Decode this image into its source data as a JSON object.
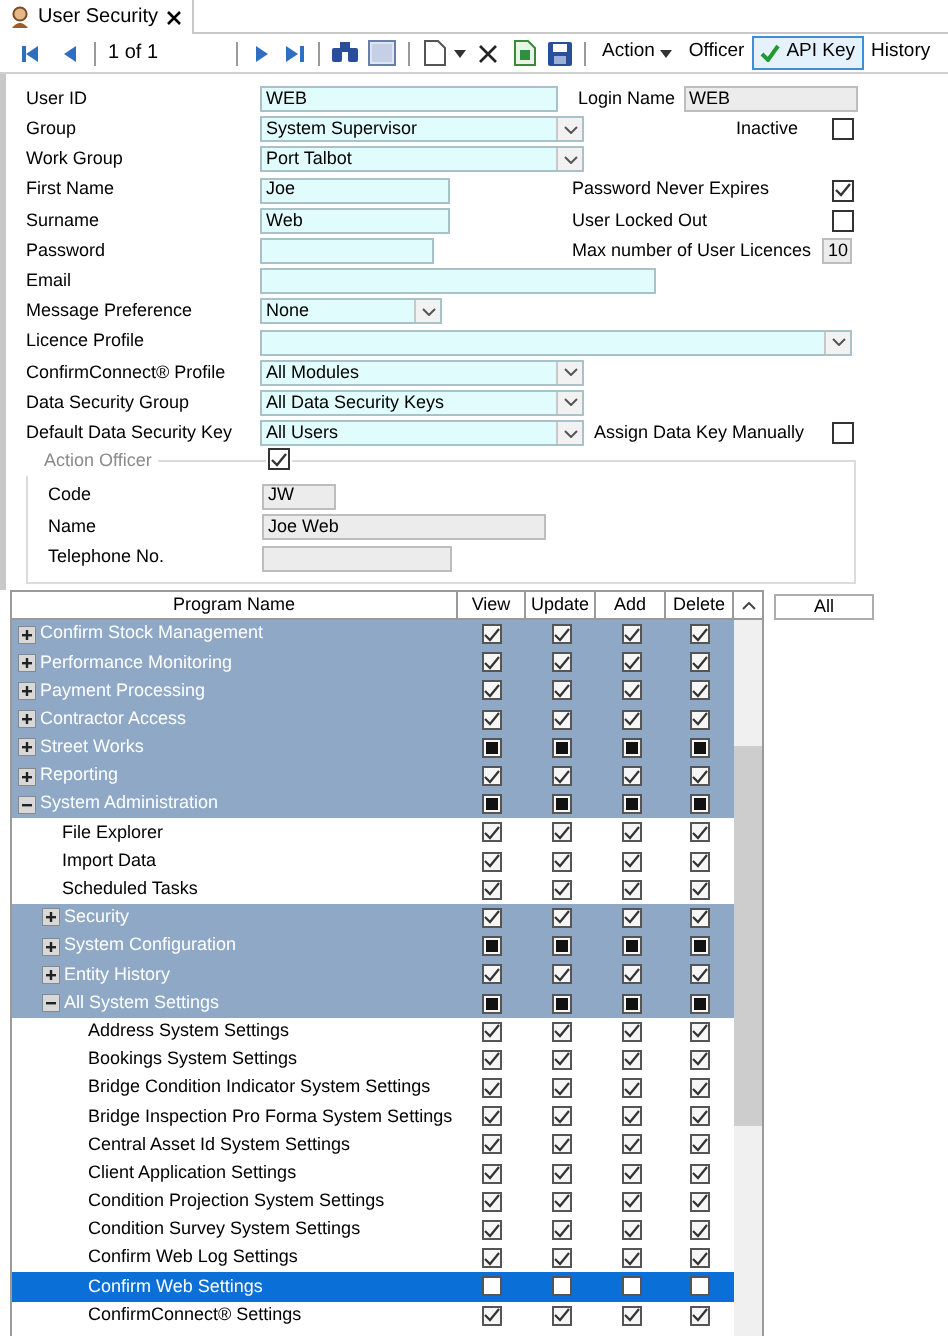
{
  "tab": {
    "title": "User Security"
  },
  "toolbar": {
    "record": "1 of 1",
    "buttons": [
      {
        "label": "Action",
        "kind": "menu",
        "selected": false
      },
      {
        "label": "Officer",
        "kind": "plain",
        "selected": false
      },
      {
        "label": "API Key",
        "kind": "check",
        "selected": true
      },
      {
        "label": "History",
        "kind": "plain",
        "selected": false
      }
    ]
  },
  "form": {
    "user_id": {
      "label": "User ID",
      "value": "WEB"
    },
    "login_name": {
      "label": "Login Name",
      "value": "WEB"
    },
    "group": {
      "label": "Group",
      "value": "System Supervisor"
    },
    "inactive": {
      "label": "Inactive",
      "checked": false
    },
    "work_group": {
      "label": "Work Group",
      "value": "Port Talbot"
    },
    "first_name": {
      "label": "First Name",
      "value": "Joe"
    },
    "password_never_expires": {
      "label": "Password Never Expires",
      "checked": true
    },
    "surname": {
      "label": "Surname",
      "value": "Web"
    },
    "user_locked_out": {
      "label": "User Locked Out",
      "checked": false
    },
    "password": {
      "label": "Password"
    },
    "max_user_licences": {
      "label": "Max number of User Licences",
      "value": "10"
    },
    "email": {
      "label": "Email"
    },
    "message_preference": {
      "label": "Message Preference",
      "value": "None"
    },
    "licence_profile": {
      "label": "Licence Profile"
    },
    "confirmconnect_profile": {
      "label": "ConfirmConnect® Profile",
      "value": "All Modules"
    },
    "data_security_group": {
      "label": "Data Security Group",
      "value": "All Data Security Keys"
    },
    "default_data_security_key": {
      "label": "Default Data Security Key",
      "value": "All Users"
    },
    "assign_data_key_manually": {
      "label": "Assign Data Key Manually",
      "checked": false
    },
    "action_officer": {
      "label": "Action Officer",
      "checked": true,
      "code": {
        "label": "Code",
        "value": "JW"
      },
      "name": {
        "label": "Name",
        "value": "Joe Web"
      },
      "telephone": {
        "label": "Telephone No."
      }
    }
  },
  "grid": {
    "columns": [
      "Program Name",
      "View",
      "Update",
      "Add",
      "Delete"
    ],
    "rows": [
      {
        "name": "Confirm Stock Management",
        "kind": "group",
        "expanded": false,
        "selected": false,
        "access": [
          {
            "checked": true,
            "indeterminate": false
          },
          {
            "checked": true,
            "indeterminate": false
          },
          {
            "checked": true,
            "indeterminate": false
          },
          {
            "checked": true,
            "indeterminate": false
          }
        ]
      },
      {
        "name": "Performance Monitoring",
        "kind": "group",
        "expanded": false,
        "selected": false,
        "access": [
          {
            "checked": true,
            "indeterminate": false
          },
          {
            "checked": true,
            "indeterminate": false
          },
          {
            "checked": true,
            "indeterminate": false
          },
          {
            "checked": true,
            "indeterminate": false
          }
        ]
      },
      {
        "name": "Payment Processing",
        "kind": "group",
        "expanded": false,
        "selected": false,
        "access": [
          {
            "checked": true,
            "indeterminate": false
          },
          {
            "checked": true,
            "indeterminate": false
          },
          {
            "checked": true,
            "indeterminate": false
          },
          {
            "checked": true,
            "indeterminate": false
          }
        ]
      },
      {
        "name": "Contractor Access",
        "kind": "group",
        "expanded": false,
        "selected": false,
        "access": [
          {
            "checked": true,
            "indeterminate": false
          },
          {
            "checked": true,
            "indeterminate": false
          },
          {
            "checked": true,
            "indeterminate": false
          },
          {
            "checked": true,
            "indeterminate": false
          }
        ]
      },
      {
        "name": "Street Works",
        "kind": "group",
        "expanded": false,
        "selected": false,
        "access": [
          {
            "checked": false,
            "indeterminate": true
          },
          {
            "checked": false,
            "indeterminate": true
          },
          {
            "checked": false,
            "indeterminate": true
          },
          {
            "checked": false,
            "indeterminate": true
          }
        ]
      },
      {
        "name": "Reporting",
        "kind": "group",
        "expanded": false,
        "selected": false,
        "access": [
          {
            "checked": true,
            "indeterminate": false
          },
          {
            "checked": true,
            "indeterminate": false
          },
          {
            "checked": true,
            "indeterminate": false
          },
          {
            "checked": true,
            "indeterminate": false
          }
        ]
      },
      {
        "name": "System Administration",
        "kind": "group",
        "expanded": true,
        "selected": false,
        "access": [
          {
            "checked": false,
            "indeterminate": true
          },
          {
            "checked": false,
            "indeterminate": true
          },
          {
            "checked": false,
            "indeterminate": true
          },
          {
            "checked": false,
            "indeterminate": true
          }
        ],
        "children": [
          {
            "name": "File Explorer",
            "kind": "item",
            "selected": false,
            "access": [
              {
                "checked": true,
                "indeterminate": false
              },
              {
                "checked": true,
                "indeterminate": false
              },
              {
                "checked": true,
                "indeterminate": false
              },
              {
                "checked": true,
                "indeterminate": false
              }
            ]
          },
          {
            "name": "Import Data",
            "kind": "item",
            "selected": false,
            "access": [
              {
                "checked": true,
                "indeterminate": false
              },
              {
                "checked": true,
                "indeterminate": false
              },
              {
                "checked": true,
                "indeterminate": false
              },
              {
                "checked": true,
                "indeterminate": false
              }
            ]
          },
          {
            "name": "Scheduled Tasks",
            "kind": "item",
            "selected": false,
            "access": [
              {
                "checked": true,
                "indeterminate": false
              },
              {
                "checked": true,
                "indeterminate": false
              },
              {
                "checked": true,
                "indeterminate": false
              },
              {
                "checked": true,
                "indeterminate": false
              }
            ]
          },
          {
            "name": "Security",
            "kind": "group",
            "expanded": false,
            "selected": false,
            "access": [
              {
                "checked": true,
                "indeterminate": false
              },
              {
                "checked": true,
                "indeterminate": false
              },
              {
                "checked": true,
                "indeterminate": false
              },
              {
                "checked": true,
                "indeterminate": false
              }
            ]
          },
          {
            "name": "System Configuration",
            "kind": "group",
            "expanded": false,
            "selected": false,
            "access": [
              {
                "checked": false,
                "indeterminate": true
              },
              {
                "checked": false,
                "indeterminate": true
              },
              {
                "checked": false,
                "indeterminate": true
              },
              {
                "checked": false,
                "indeterminate": true
              }
            ]
          },
          {
            "name": "Entity History",
            "kind": "group",
            "expanded": false,
            "selected": false,
            "access": [
              {
                "checked": true,
                "indeterminate": false
              },
              {
                "checked": true,
                "indeterminate": false
              },
              {
                "checked": true,
                "indeterminate": false
              },
              {
                "checked": true,
                "indeterminate": false
              }
            ]
          },
          {
            "name": "All System Settings",
            "kind": "group",
            "expanded": true,
            "selected": false,
            "access": [
              {
                "checked": false,
                "indeterminate": true
              },
              {
                "checked": false,
                "indeterminate": true
              },
              {
                "checked": false,
                "indeterminate": true
              },
              {
                "checked": false,
                "indeterminate": true
              }
            ],
            "children": [
              {
                "name": "Address System Settings",
                "kind": "item",
                "selected": false,
                "access": [
                  {
                    "checked": true,
                    "indeterminate": false
                  },
                  {
                    "checked": true,
                    "indeterminate": false
                  },
                  {
                    "checked": true,
                    "indeterminate": false
                  },
                  {
                    "checked": true,
                    "indeterminate": false
                  }
                ]
              },
              {
                "name": "Bookings System Settings",
                "kind": "item",
                "selected": false,
                "access": [
                  {
                    "checked": true,
                    "indeterminate": false
                  },
                  {
                    "checked": true,
                    "indeterminate": false
                  },
                  {
                    "checked": true,
                    "indeterminate": false
                  },
                  {
                    "checked": true,
                    "indeterminate": false
                  }
                ]
              },
              {
                "name": "Bridge Condition Indicator System Settings",
                "kind": "item",
                "selected": false,
                "access": [
                  {
                    "checked": true,
                    "indeterminate": false
                  },
                  {
                    "checked": true,
                    "indeterminate": false
                  },
                  {
                    "checked": true,
                    "indeterminate": false
                  },
                  {
                    "checked": true,
                    "indeterminate": false
                  }
                ]
              },
              {
                "name": "Bridge Inspection Pro Forma System Settings",
                "kind": "item",
                "selected": false,
                "access": [
                  {
                    "checked": true,
                    "indeterminate": false
                  },
                  {
                    "checked": true,
                    "indeterminate": false
                  },
                  {
                    "checked": true,
                    "indeterminate": false
                  },
                  {
                    "checked": true,
                    "indeterminate": false
                  }
                ]
              },
              {
                "name": "Central Asset Id System Settings",
                "kind": "item",
                "selected": false,
                "access": [
                  {
                    "checked": true,
                    "indeterminate": false
                  },
                  {
                    "checked": true,
                    "indeterminate": false
                  },
                  {
                    "checked": true,
                    "indeterminate": false
                  },
                  {
                    "checked": true,
                    "indeterminate": false
                  }
                ]
              },
              {
                "name": "Client Application Settings",
                "kind": "item",
                "selected": false,
                "access": [
                  {
                    "checked": true,
                    "indeterminate": false
                  },
                  {
                    "checked": true,
                    "indeterminate": false
                  },
                  {
                    "checked": true,
                    "indeterminate": false
                  },
                  {
                    "checked": true,
                    "indeterminate": false
                  }
                ]
              },
              {
                "name": "Condition Projection System Settings",
                "kind": "item",
                "selected": false,
                "access": [
                  {
                    "checked": true,
                    "indeterminate": false
                  },
                  {
                    "checked": true,
                    "indeterminate": false
                  },
                  {
                    "checked": true,
                    "indeterminate": false
                  },
                  {
                    "checked": true,
                    "indeterminate": false
                  }
                ]
              },
              {
                "name": "Condition Survey System Settings",
                "kind": "item",
                "selected": false,
                "access": [
                  {
                    "checked": true,
                    "indeterminate": false
                  },
                  {
                    "checked": true,
                    "indeterminate": false
                  },
                  {
                    "checked": true,
                    "indeterminate": false
                  },
                  {
                    "checked": true,
                    "indeterminate": false
                  }
                ]
              },
              {
                "name": "Confirm Web Log Settings",
                "kind": "item",
                "selected": false,
                "access": [
                  {
                    "checked": true,
                    "indeterminate": false
                  },
                  {
                    "checked": true,
                    "indeterminate": false
                  },
                  {
                    "checked": true,
                    "indeterminate": false
                  },
                  {
                    "checked": true,
                    "indeterminate": false
                  }
                ]
              },
              {
                "name": "Confirm Web Settings",
                "kind": "item",
                "selected": true,
                "access": [
                  {
                    "checked": false,
                    "indeterminate": false
                  },
                  {
                    "checked": false,
                    "indeterminate": false
                  },
                  {
                    "checked": false,
                    "indeterminate": false
                  },
                  {
                    "checked": false,
                    "indeterminate": false
                  }
                ]
              },
              {
                "name": "ConfirmConnect® Settings",
                "kind": "item",
                "selected": false,
                "access": [
                  {
                    "checked": true,
                    "indeterminate": false
                  },
                  {
                    "checked": true,
                    "indeterminate": false
                  },
                  {
                    "checked": true,
                    "indeterminate": false
                  },
                  {
                    "checked": true,
                    "indeterminate": false
                  }
                ]
              }
            ]
          }
        ]
      }
    ]
  },
  "all_button": {
    "label": "All"
  }
}
